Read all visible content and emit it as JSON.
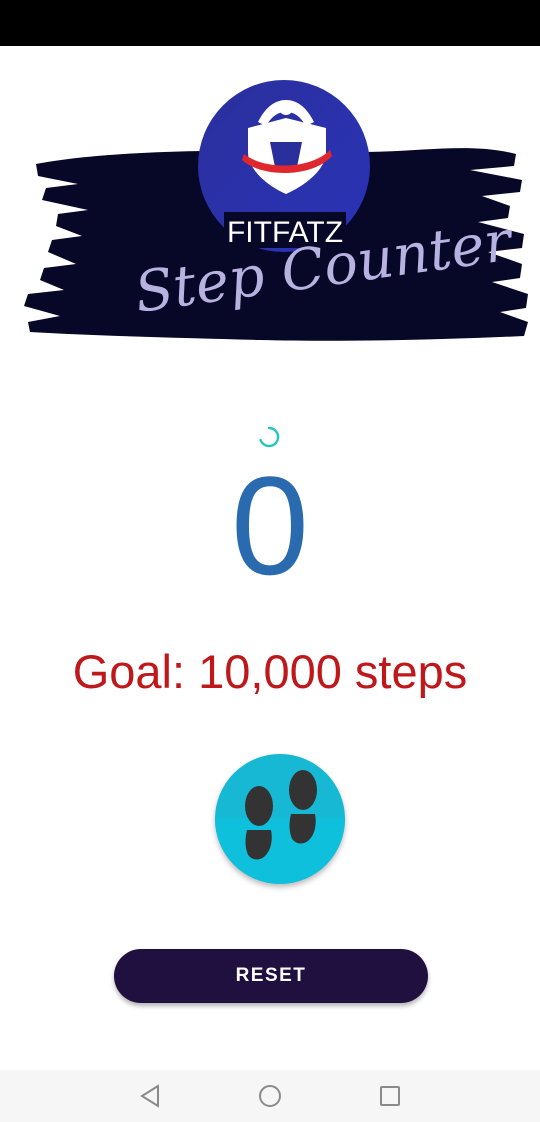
{
  "banner": {
    "logo_text": "FITFATZ",
    "script_title": "Step Counter"
  },
  "counter": {
    "steps": "0"
  },
  "goal": {
    "text": "Goal: 10,000 steps"
  },
  "actions": {
    "footsteps_icon": "footsteps-icon",
    "reset_label": "RESET"
  },
  "colors": {
    "step_count": "#2a6aae",
    "goal_text": "#c0171b",
    "footsteps_button": "#16b8d3",
    "reset_button": "#201040",
    "banner_brush": "#070728",
    "spinner": "#22c7c0"
  },
  "navigation": {
    "icons": [
      "back-triangle-icon",
      "home-circle-icon",
      "recents-square-icon"
    ]
  }
}
